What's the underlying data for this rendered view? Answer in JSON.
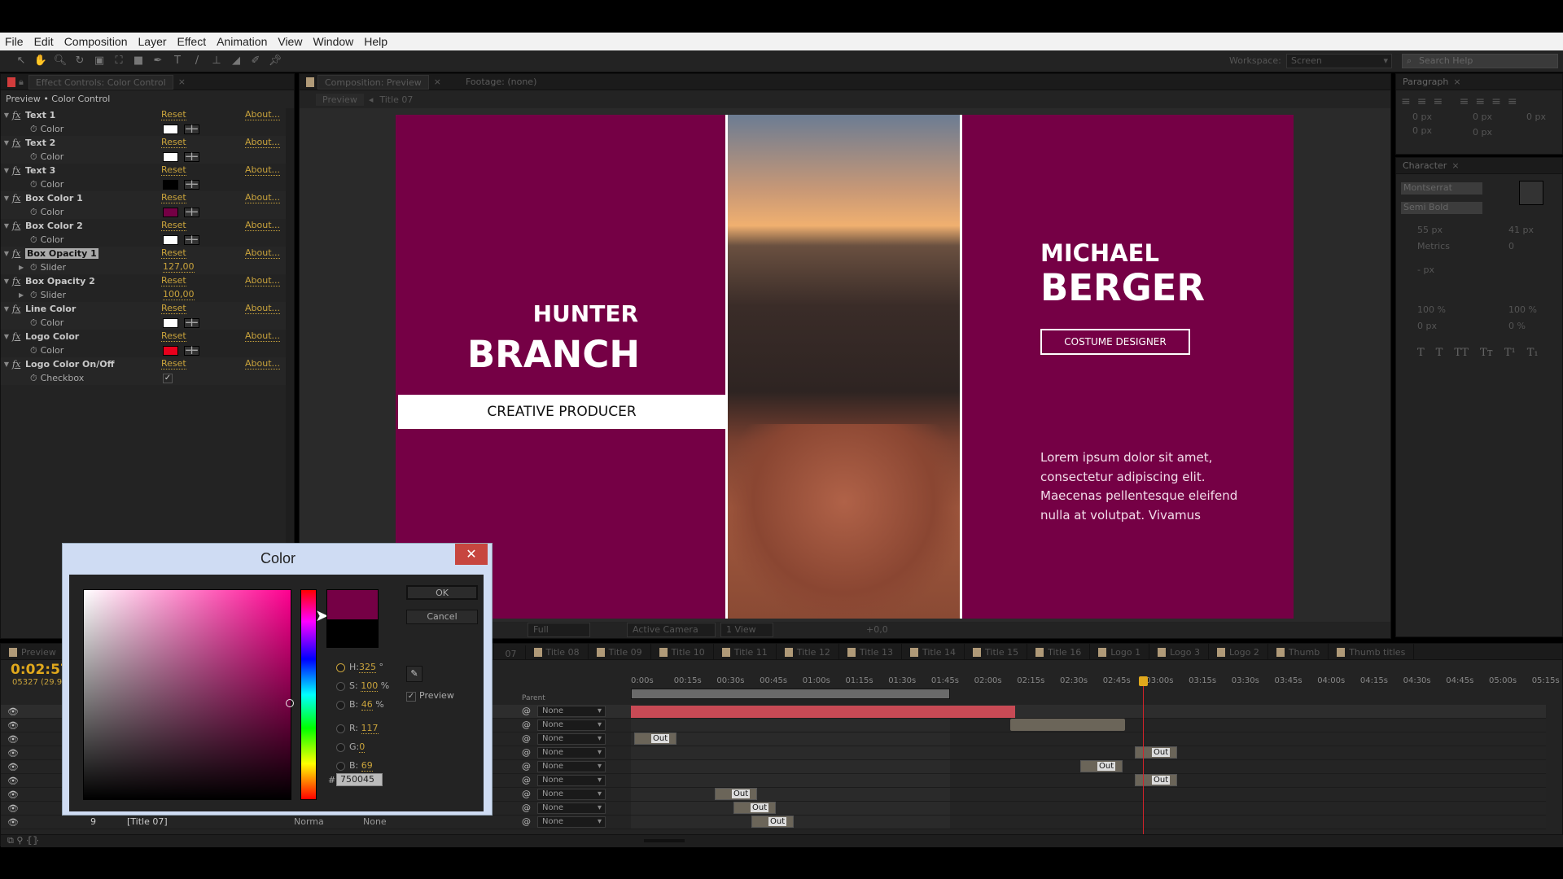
{
  "menu": [
    "File",
    "Edit",
    "Composition",
    "Layer",
    "Effect",
    "Animation",
    "View",
    "Window",
    "Help"
  ],
  "toolbar": {
    "tools": [
      "selection-tool",
      "hand-tool",
      "zoom-tool",
      "rotate-tool",
      "camera-tool",
      "pan-behind-tool",
      "rectangle-tool",
      "pen-tool",
      "type-tool",
      "brush-tool",
      "clone-stamp-tool",
      "eraser-tool",
      "roto-brush-tool",
      "puppet-pin-tool"
    ],
    "workspace_label": "Workspace:",
    "workspace_value": "Screen",
    "search_placeholder": "Search Help"
  },
  "effect_controls": {
    "tab": "Effect Controls: Color Control",
    "breadcrumb": "Preview • Color Control",
    "reset": "Reset",
    "about": "About...",
    "effects": [
      {
        "name": "Text 1",
        "param": "Color",
        "type": "color",
        "value": "#ffffff"
      },
      {
        "name": "Text 2",
        "param": "Color",
        "type": "color",
        "value": "#ffffff"
      },
      {
        "name": "Text 3",
        "param": "Color",
        "type": "color",
        "value": "#000000"
      },
      {
        "name": "Box Color 1",
        "param": "Color",
        "type": "color",
        "value": "#750045"
      },
      {
        "name": "Box Color 2",
        "param": "Color",
        "type": "color",
        "value": "#ffffff"
      },
      {
        "name": "Box Opacity 1",
        "param": "Slider",
        "type": "slider",
        "value": "127,00",
        "selected": true
      },
      {
        "name": "Box Opacity 2",
        "param": "Slider",
        "type": "slider",
        "value": "100,00"
      },
      {
        "name": "Line Color",
        "param": "Color",
        "type": "color",
        "value": "#ffffff"
      },
      {
        "name": "Logo Color",
        "param": "Color",
        "type": "color",
        "value": "#e8001c"
      },
      {
        "name": "Logo Color On/Off",
        "param": "Checkbox",
        "type": "checkbox",
        "value": "✓"
      }
    ]
  },
  "composition": {
    "tab": "Composition: Preview",
    "footage_tab": "Footage: (none)",
    "nav": [
      "Preview",
      "Title 07"
    ],
    "box_color": "#750045",
    "left": {
      "first": "HUNTER",
      "last": "BRANCH",
      "role": "CREATIVE PRODUCER"
    },
    "right": {
      "first": "MICHAEL",
      "last": "BERGER",
      "role": "COSTUME DESIGNER",
      "body": [
        "Lorem ipsum dolor sit amet,",
        "consectetur adipiscing elit.",
        "Maecenas pellentesque eleifend",
        "nulla at volutpat. Vivamus"
      ]
    },
    "viewer_toolbar": {
      "resolution": "Full",
      "camera": "Active Camera",
      "views": "1 View",
      "exposure": "+0,0"
    }
  },
  "paragraph": {
    "tab": "Paragraph",
    "fields": [
      "0 px",
      "0 px",
      "0 px",
      "0 px",
      "0 px"
    ]
  },
  "character": {
    "tab": "Character",
    "font": "Montserrat",
    "style": "Semi Bold",
    "size": "55 px",
    "leading": "41 px",
    "kerning": "Metrics",
    "tracking": "0",
    "stroke": "- px",
    "vscale": "100 %",
    "hscale": "100 %",
    "baseline": "0 px",
    "tsume": "0 %",
    "styles": [
      "T",
      "T",
      "TT",
      "Tт",
      "T¹",
      "T₁"
    ]
  },
  "timeline": {
    "first_tab": "Preview",
    "tabs": [
      "07",
      "Title 08",
      "Title 09",
      "Title 10",
      "Title 11",
      "Title 12",
      "Title 13",
      "Title 14",
      "Title 15",
      "Title 16",
      "Logo 1",
      "Logo 3",
      "Logo 2",
      "Thumb",
      "Thumb titles"
    ],
    "timecode": "0:02:57:",
    "frames": "05327 (29.97",
    "parent_header": "Parent",
    "ruler": [
      "0:00s",
      "00:15s",
      "00:30s",
      "00:45s",
      "01:00s",
      "01:15s",
      "01:30s",
      "01:45s",
      "02:00s",
      "02:15s",
      "02:30s",
      "02:45s",
      "03:00s",
      "03:15s",
      "03:30s",
      "03:45s",
      "04:00s",
      "04:15s",
      "04:30s",
      "04:45s",
      "05:00s",
      "05:15s"
    ],
    "parent_value": "None",
    "marker_label": "Out",
    "visible_layer": {
      "number": "9",
      "name": "[Title 07]",
      "mode": "Norma",
      "trkmat": "None"
    },
    "playhead_time": "03:00s",
    "red_bar_color": "#c84a55"
  },
  "color_dialog": {
    "title": "Color",
    "ok": "OK",
    "cancel": "Cancel",
    "preview_label": "Preview",
    "preview_checked": true,
    "new_color": "#750045",
    "old_color": "#000000",
    "H": "325",
    "H_unit": "°",
    "S": "100",
    "S_unit": "%",
    "B": "46",
    "B_unit": "%",
    "R": "117",
    "G": "0",
    "Bl": "69",
    "hex": "750045",
    "labels": {
      "H": "H:",
      "S": "S:",
      "B": "B:",
      "R": "R:",
      "G": "G:",
      "Bl": "B:",
      "hash": "#"
    }
  }
}
